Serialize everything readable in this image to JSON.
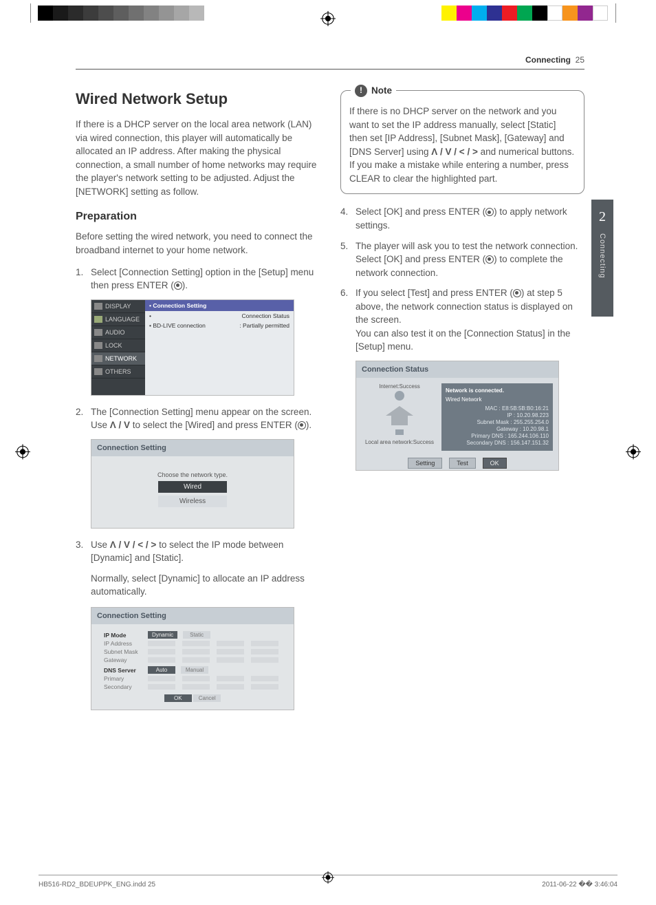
{
  "header": {
    "section": "Connecting",
    "page": "25"
  },
  "sideTab": {
    "chapter": "2",
    "label": "Connecting"
  },
  "left": {
    "title": "Wired Network Setup",
    "intro": "If there is a DHCP server on the local area network (LAN) via wired connection, this player will automatically be allocated an IP address. After making the physical connection, a small number of home networks may require the player's network setting to be adjusted. Adjust the [NETWORK] setting as follow.",
    "prepTitle": "Preparation",
    "prepText": "Before setting the wired network, you need to connect the broadband internet to your home network.",
    "steps": {
      "s1a": "Select [Connection Setting] option in the [Setup] menu then press ENTER (",
      "s1b": ").",
      "s2a": "The [Connection Setting] menu appear on the screen. Use ",
      "s2arrows": "Λ / V",
      "s2b": " to select the [Wired] and press ENTER (",
      "s2c": ").",
      "s3a": "Use ",
      "s3arrows": "Λ / V / < / >",
      "s3b": " to select the IP mode between [Dynamic] and [Static].",
      "s3note": "Normally, select [Dynamic] to allocate an IP address automatically."
    }
  },
  "shot1": {
    "menu": [
      "DISPLAY",
      "LANGUAGE",
      "AUDIO",
      "LOCK",
      "NETWORK",
      "OTHERS"
    ],
    "active": "Connection Setting",
    "row2": "Connection Status",
    "row3a": "BD-LIVE connection",
    "row3b": ": Partially permitted"
  },
  "shot2": {
    "title": "Connection Setting",
    "prompt": "Choose the network type.",
    "options": [
      "Wired",
      "Wireless"
    ]
  },
  "shot3": {
    "title": "Connection Setting",
    "ipmode": "IP Mode",
    "dynamic": "Dynamic",
    "static": "Static",
    "ipaddr": "IP Address",
    "subnet": "Subnet Mask",
    "gateway": "Gateway",
    "dns": "DNS Server",
    "auto": "Auto",
    "manual": "Manual",
    "primary": "Primary",
    "secondary": "Secondary",
    "ok": "OK",
    "cancel": "Cancel"
  },
  "right": {
    "noteLabel": "Note",
    "noteA": "If there is no DHCP server on the network and you want to set the IP address manually, select [Static] then set [IP Address], [Subnet Mask], [Gateway] and [DNS Server] using ",
    "noteArrows": "Λ / V / < / >",
    "noteB": " and numerical buttons. If you make a mistake while entering a number, press CLEAR to clear the highlighted part.",
    "s4a": "Select [OK] and press ENTER (",
    "s4b": ") to apply network settings.",
    "s5a": "The player will ask you to test the network connection. Select [OK] and press ENTER (",
    "s5b": ") to complete the network connection.",
    "s6a": "If you select [Test] and press ENTER (",
    "s6b": ") at step 5 above, the network connection status is displayed on the screen.",
    "s6c": "You can also test it on the [Connection Status] in the [Setup] menu."
  },
  "shot4": {
    "title": "Connection Status",
    "internet": "Internet:Success",
    "lan": "Local area network:Success",
    "connected": "Network is connected.",
    "type": "Wired Network",
    "mac": "MAC : E8:5B:5B:B0:16:21",
    "ip": "IP : 10.20.98.223",
    "mask": "Subnet Mask : 255.255.254.0",
    "gw": "Gateway : 10.20.98.1",
    "pdns": "Primary DNS : 165.244.106.110",
    "sdns": "Secondary DNS : 156.147.151.32",
    "setting": "Setting",
    "test": "Test",
    "ok": "OK"
  },
  "footer": {
    "file": "HB516-RD2_BDEUPPK_ENG.indd   25",
    "date": "2011-06-22   �� 3:46:04"
  },
  "printbar": {
    "grays": [
      "#000",
      "#1a1a1a",
      "#2b2b2b",
      "#3c3c3c",
      "#4d4d4d",
      "#5e5e5e",
      "#707070",
      "#828282",
      "#949494",
      "#a6a6a6",
      "#b8b8b8"
    ],
    "colors": [
      "#fff200",
      "#ec008c",
      "#00aeef",
      "#2e3192",
      "#ed1c24",
      "#00a651",
      "#000000",
      "#ffffff",
      "#f7941d",
      "#92278f",
      "#fff"
    ]
  }
}
